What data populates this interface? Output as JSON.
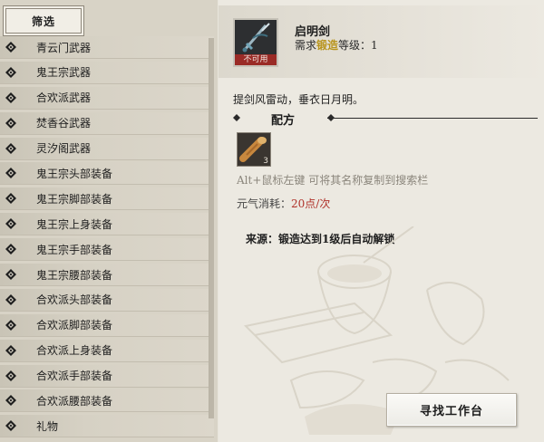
{
  "filter": {
    "tab_label": "筛选"
  },
  "categories": [
    {
      "label": "青云门武器"
    },
    {
      "label": "鬼王宗武器"
    },
    {
      "label": "合欢派武器"
    },
    {
      "label": "焚香谷武器"
    },
    {
      "label": "灵汐阁武器"
    },
    {
      "label": "鬼王宗头部装备"
    },
    {
      "label": "鬼王宗脚部装备"
    },
    {
      "label": "鬼王宗上身装备"
    },
    {
      "label": "鬼王宗手部装备"
    },
    {
      "label": "鬼王宗腰部装备"
    },
    {
      "label": "合欢派头部装备"
    },
    {
      "label": "合欢派脚部装备"
    },
    {
      "label": "合欢派上身装备"
    },
    {
      "label": "合欢派手部装备"
    },
    {
      "label": "合欢派腰部装备"
    },
    {
      "label": "礼物"
    }
  ],
  "detail": {
    "item_name": "启明剑",
    "unusable_badge": "不可用",
    "req_prefix": "需求",
    "req_skill": "锻造",
    "req_suffix": "等级：1",
    "description": "提剑风雷动，垂衣日月明。",
    "recipe_title": "配方",
    "material_count": "3",
    "hint": "Alt+鼠标左键 可将其名称复制到搜索栏",
    "energy_label": "元气消耗：",
    "energy_value": "20点/次",
    "source_label": "来源：",
    "source_value": "锻造达到1级后自动解锁",
    "icons": {
      "bullet": "diamond-bullet-icon",
      "item": "sword-icon",
      "material": "wood-material-icon"
    }
  },
  "buttons": {
    "find_workbench": "寻找工作台"
  },
  "colors": {
    "skill_highlight": "#b8941d",
    "energy_value": "#b0322a",
    "unusable_badge": "#9a2b26"
  }
}
